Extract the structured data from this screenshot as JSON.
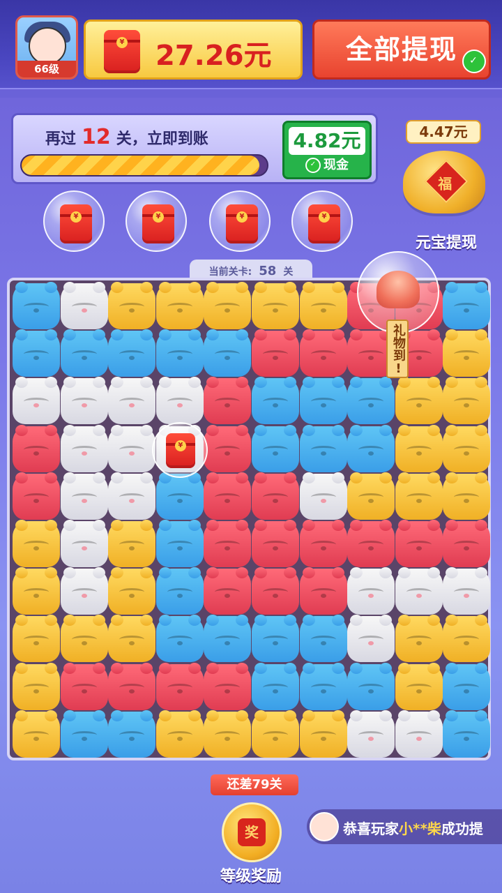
{
  "header": {
    "level_badge": "66级",
    "balance": "27.26元",
    "withdraw_all": "全部提现",
    "wechat_icon": "wechat-icon"
  },
  "progress": {
    "prefix": "再过",
    "levels_left": "12",
    "suffix": "关，立即到账",
    "fill_fraction": 0.97,
    "cash_amount": "4.82元",
    "cash_label": "现金"
  },
  "bubbles": [
    {
      "icon": "red-envelope-icon"
    },
    {
      "icon": "red-envelope-icon"
    },
    {
      "icon": "red-envelope-icon"
    },
    {
      "icon": "red-envelope-icon"
    }
  ],
  "yuanbao": {
    "amount": "4.47元",
    "fu_char": "福",
    "label": "元宝提现"
  },
  "level_indicator": {
    "label": "当前关卡:",
    "value": "58",
    "unit": "关"
  },
  "gift": {
    "tag": "礼物到!"
  },
  "board": {
    "colors": {
      "b": "#3a9ee8",
      "w": "#e6e6ee",
      "y": "#f5c53a",
      "r": "#ee4a5e"
    },
    "grid": [
      [
        "b",
        "w",
        "y",
        "y",
        "y",
        "y",
        "y",
        "r",
        "r",
        "b"
      ],
      [
        "b",
        "b",
        "b",
        "b",
        "b",
        "r",
        "r",
        "r",
        "r",
        "y"
      ],
      [
        "w",
        "w",
        "w",
        "w",
        "r",
        "b",
        "b",
        "b",
        "y",
        "y"
      ],
      [
        "r",
        "w",
        "w",
        "w",
        "r",
        "b",
        "b",
        "b",
        "y",
        "y"
      ],
      [
        "r",
        "w",
        "w",
        "b",
        "r",
        "r",
        "w",
        "y",
        "y",
        "y"
      ],
      [
        "y",
        "w",
        "y",
        "b",
        "r",
        "r",
        "r",
        "r",
        "r",
        "r"
      ],
      [
        "y",
        "w",
        "y",
        "b",
        "r",
        "r",
        "r",
        "w",
        "w",
        "w"
      ],
      [
        "y",
        "y",
        "y",
        "b",
        "b",
        "b",
        "b",
        "w",
        "y",
        "y"
      ],
      [
        "y",
        "r",
        "r",
        "r",
        "r",
        "b",
        "b",
        "b",
        "y",
        "b"
      ],
      [
        "y",
        "b",
        "b",
        "y",
        "y",
        "y",
        "y",
        "w",
        "w",
        "b"
      ]
    ],
    "bubble_tile": {
      "row": 3,
      "col": 3,
      "icon": "red-envelope-icon"
    }
  },
  "footer": {
    "remain_tag": "还差79关",
    "reward_char": "奖",
    "reward_label": "等级奖励",
    "ticker_prefix": "恭喜玩家",
    "ticker_name": "小**柴",
    "ticker_suffix": "成功提"
  }
}
